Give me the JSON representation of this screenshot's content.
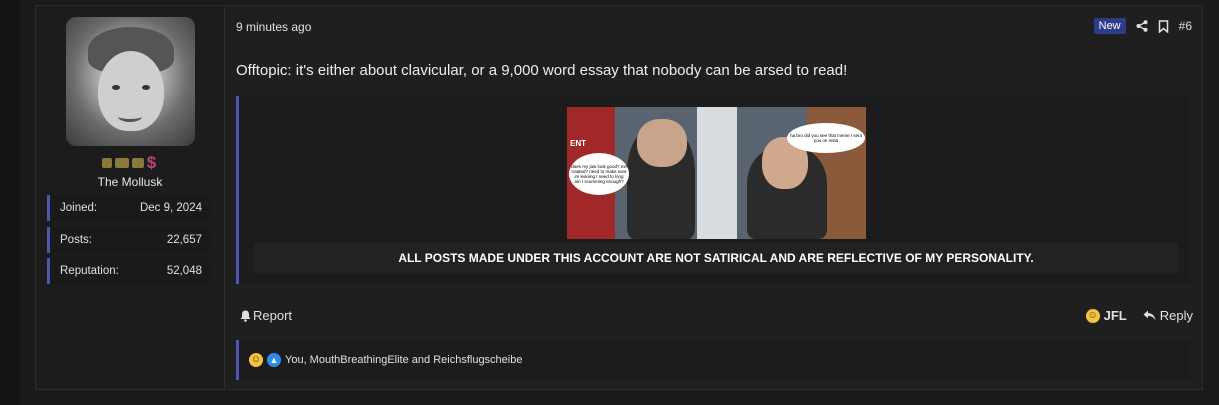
{
  "user": {
    "name": "The Mollusk",
    "banner_symbol": "$",
    "stats": [
      {
        "label": "Joined:",
        "value": "Dec 9, 2024"
      },
      {
        "label": "Posts:",
        "value": "22,657"
      },
      {
        "label": "Reputation:",
        "value": "52,048"
      }
    ]
  },
  "post": {
    "time": "9 minutes ago",
    "badge": "New",
    "number": "#6",
    "message": "Offtopic: it's either about clavicular, or a 9,000 word essay that nobody can be arsed to read!"
  },
  "signature": {
    "meme_sign_text": "ENT",
    "bubble_left": "does my jaw look good? ext rotated? need to make sure im leaning I need to long am I scumming enough?",
    "bubble_right": "ha bro did you see that meme I sent you on insta",
    "caption": "ALL POSTS MADE UNDER THIS ACCOUNT ARE NOT SATIRICAL AND ARE REFLECTIVE OF MY PERSONALITY."
  },
  "actions": {
    "report": "Report",
    "jfl": "JFL",
    "reply": "Reply"
  },
  "reactions": {
    "text": "You, MouthBreathingElite and Reichsflugscheibe"
  },
  "colors": {
    "accent": "#4a57b0",
    "badge": "#2c3c8a"
  }
}
